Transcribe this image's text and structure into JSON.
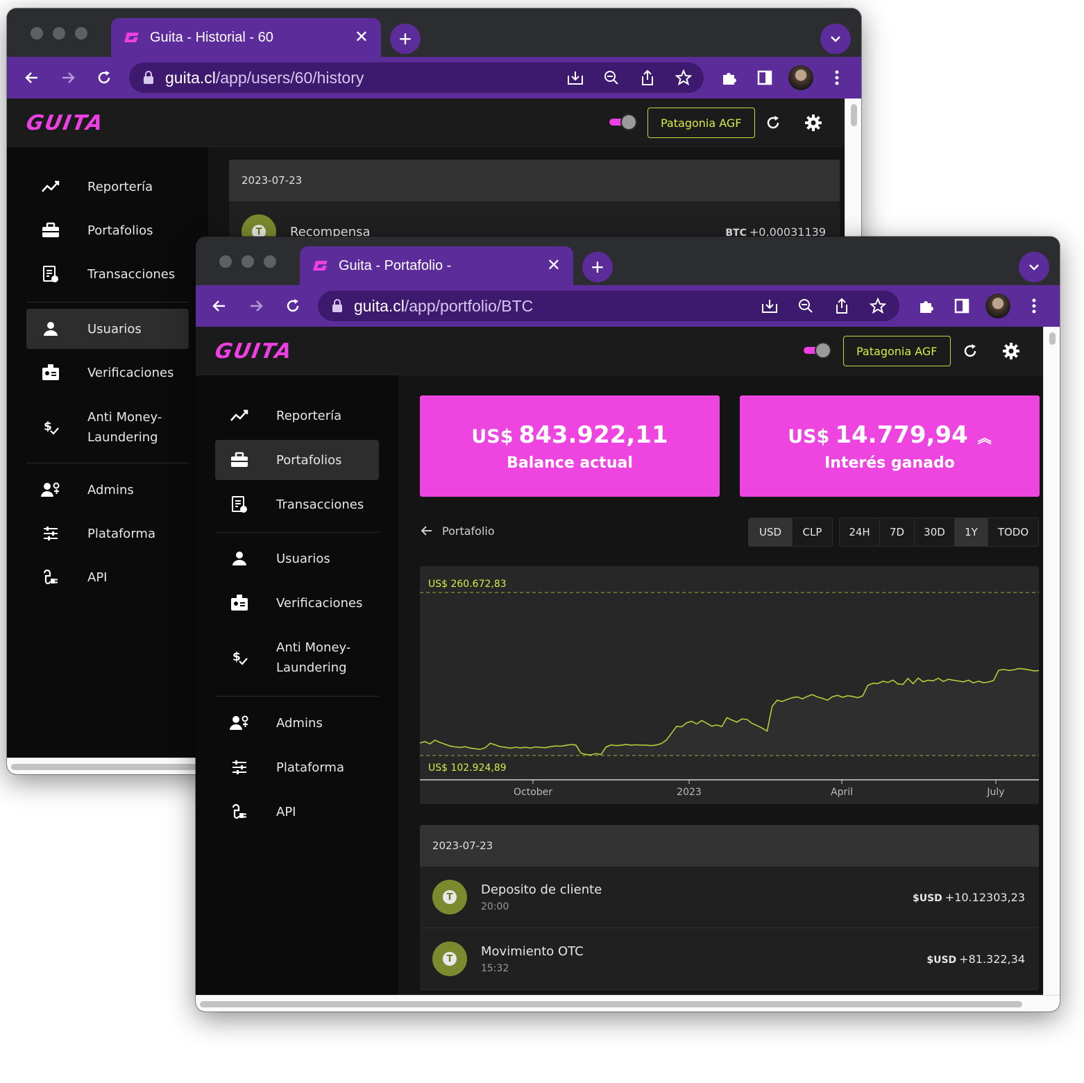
{
  "back_window": {
    "tab_title": "Guita - Historial - 60",
    "url_host": "guita.cl",
    "url_path": "/app/users/60/history",
    "app_logo": "GUITA",
    "org_button": "Patagonia AGF",
    "nav": [
      "Reportería",
      "Portafolios",
      "Transacciones",
      "Usuarios",
      "Verificaciones",
      "Anti Money-\nLaundering",
      "Admins",
      "Plataforma",
      "API"
    ],
    "active_nav": "Usuarios",
    "history_date": "2023-07-23",
    "history_item": {
      "title": "Recompensa",
      "currency": "BTC",
      "amount": "+0,00031139"
    }
  },
  "front_window": {
    "tab_title": "Guita - Portafolio -",
    "url_host": "guita.cl",
    "url_path": "/app/portfolio/BTC",
    "app_logo": "GUITA",
    "org_button": "Patagonia AGF",
    "nav": [
      "Reportería",
      "Portafolios",
      "Transacciones",
      "Usuarios",
      "Verificaciones",
      "Anti Money-\nLaundering",
      "Admins",
      "Plataforma",
      "API"
    ],
    "active_nav": "Portafolios",
    "balance": {
      "currency": "US$",
      "value": "843.922,11",
      "label": "Balance actual"
    },
    "interest": {
      "currency": "US$",
      "value": "14.779,94",
      "label": "Interés ganado"
    },
    "back_link": "Portafolio",
    "currency_options": [
      "USD",
      "CLP"
    ],
    "selected_currency": "USD",
    "range_options": [
      "24H",
      "7D",
      "30D",
      "1Y",
      "TODO"
    ],
    "selected_range": "1Y",
    "history_date": "2023-07-23",
    "history": [
      {
        "title": "Deposito de cliente",
        "time": "20:00",
        "currency": "$USD",
        "amount": "+10.12303,23"
      },
      {
        "title": "Movimiento OTC",
        "time": "15:32",
        "currency": "$USD",
        "amount": "+81.322,34"
      }
    ]
  },
  "colors": {
    "accent": "#ee45e1",
    "chart_line": "#b9cc3a",
    "sidebar_bg": "#0b0b0b",
    "browser_purple": "#5c2c9a"
  },
  "chart_data": {
    "type": "line",
    "max_label": "US$ 260.672,83",
    "min_label": "US$ 102.924,89",
    "x_ticks": [
      "October",
      "2023",
      "April",
      "July"
    ],
    "ylim": [
      102924.89,
      260672.83
    ],
    "series": [
      {
        "values": [
          115000,
          116500,
          114200,
          117800,
          115600,
          113900,
          112100,
          111300,
          110800,
          111500,
          110200,
          109500,
          108900,
          110600,
          114800,
          113200,
          111500,
          110900,
          110100,
          111000,
          110400,
          110900,
          110200,
          111300,
          110800,
          110500,
          111600,
          112200,
          111900,
          112800,
          113500,
          113100,
          105200,
          104000,
          103600,
          104800,
          103900,
          111200,
          113200,
          112500,
          112900,
          113600,
          112900,
          113300,
          113000,
          112900,
          112500,
          113100,
          114600,
          117900,
          124500,
          131200,
          130800,
          134600,
          136100,
          133500,
          136800,
          134200,
          131300,
          132500,
          130900,
          139600,
          137200,
          135300,
          138400,
          137800,
          134100,
          131900,
          129500,
          126600,
          150500,
          156500,
          155300,
          157200,
          158900,
          159700,
          157800,
          160200,
          161900,
          159600,
          158300,
          156500,
          159900,
          161200,
          159300,
          160800,
          160100,
          158800,
          160700,
          170800,
          172900,
          172600,
          174800,
          173600,
          175900,
          172200,
          171800,
          177500,
          172500,
          177900,
          174300,
          175800,
          175200,
          177800,
          174600,
          176700,
          175800,
          175100,
          174200,
          175800,
          173200,
          174900,
          173400,
          174100,
          175600,
          185400,
          186200,
          185300,
          185800,
          187100,
          186700,
          185900,
          184900,
          185100
        ]
      }
    ]
  }
}
